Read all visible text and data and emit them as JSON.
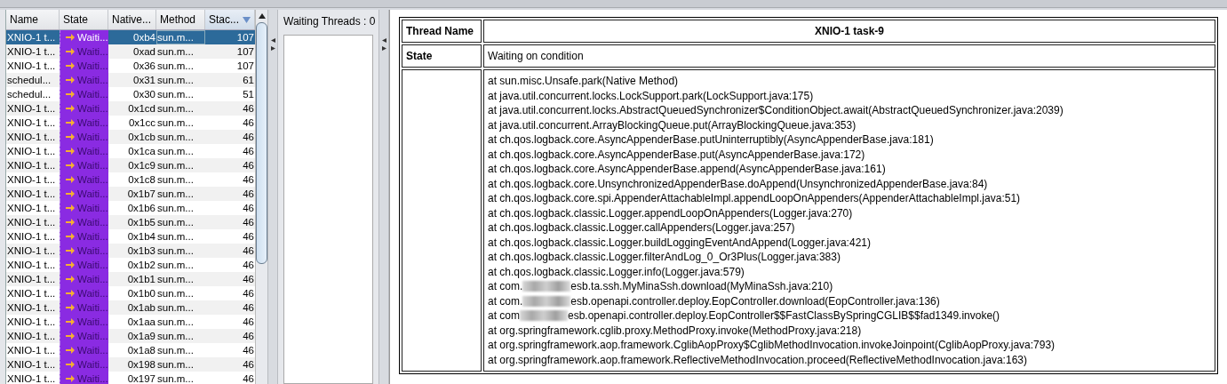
{
  "threads_table": {
    "columns": [
      {
        "label": "Name",
        "sorted": false
      },
      {
        "label": "State",
        "sorted": false
      },
      {
        "label": "Native...",
        "sorted": false
      },
      {
        "label": "Method",
        "sorted": false
      },
      {
        "label": "Stac...",
        "sorted": true
      }
    ],
    "rows": [
      {
        "name": "XNIO-1 t...",
        "state": "Waiti...",
        "native_id": "0xb4",
        "method": "sun.m...",
        "stack_depth": "107",
        "selected": true
      },
      {
        "name": "XNIO-1 t...",
        "state": "Waiti...",
        "native_id": "0xad",
        "method": "sun.m...",
        "stack_depth": "107",
        "selected": false
      },
      {
        "name": "XNIO-1 t...",
        "state": "Waiti...",
        "native_id": "0x36",
        "method": "sun.m...",
        "stack_depth": "107",
        "selected": false
      },
      {
        "name": "schedul...",
        "state": "Waiti...",
        "native_id": "0x31",
        "method": "sun.m...",
        "stack_depth": "61",
        "selected": false
      },
      {
        "name": "schedul...",
        "state": "Waiti...",
        "native_id": "0x30",
        "method": "sun.m...",
        "stack_depth": "51",
        "selected": false
      },
      {
        "name": "XNIO-1 t...",
        "state": "Waiti...",
        "native_id": "0x1cd",
        "method": "sun.m...",
        "stack_depth": "46",
        "selected": false
      },
      {
        "name": "XNIO-1 t...",
        "state": "Waiti...",
        "native_id": "0x1cc",
        "method": "sun.m...",
        "stack_depth": "46",
        "selected": false
      },
      {
        "name": "XNIO-1 t...",
        "state": "Waiti...",
        "native_id": "0x1cb",
        "method": "sun.m...",
        "stack_depth": "46",
        "selected": false
      },
      {
        "name": "XNIO-1 t...",
        "state": "Waiti...",
        "native_id": "0x1ca",
        "method": "sun.m...",
        "stack_depth": "46",
        "selected": false
      },
      {
        "name": "XNIO-1 t...",
        "state": "Waiti...",
        "native_id": "0x1c9",
        "method": "sun.m...",
        "stack_depth": "46",
        "selected": false
      },
      {
        "name": "XNIO-1 t...",
        "state": "Waiti...",
        "native_id": "0x1c8",
        "method": "sun.m...",
        "stack_depth": "46",
        "selected": false
      },
      {
        "name": "XNIO-1 t...",
        "state": "Waiti...",
        "native_id": "0x1b7",
        "method": "sun.m...",
        "stack_depth": "46",
        "selected": false
      },
      {
        "name": "XNIO-1 t...",
        "state": "Waiti...",
        "native_id": "0x1b6",
        "method": "sun.m...",
        "stack_depth": "46",
        "selected": false
      },
      {
        "name": "XNIO-1 t...",
        "state": "Waiti...",
        "native_id": "0x1b5",
        "method": "sun.m...",
        "stack_depth": "46",
        "selected": false
      },
      {
        "name": "XNIO-1 t...",
        "state": "Waiti...",
        "native_id": "0x1b4",
        "method": "sun.m...",
        "stack_depth": "46",
        "selected": false
      },
      {
        "name": "XNIO-1 t...",
        "state": "Waiti...",
        "native_id": "0x1b3",
        "method": "sun.m...",
        "stack_depth": "46",
        "selected": false
      },
      {
        "name": "XNIO-1 t...",
        "state": "Waiti...",
        "native_id": "0x1b2",
        "method": "sun.m...",
        "stack_depth": "46",
        "selected": false
      },
      {
        "name": "XNIO-1 t...",
        "state": "Waiti...",
        "native_id": "0x1b1",
        "method": "sun.m...",
        "stack_depth": "46",
        "selected": false
      },
      {
        "name": "XNIO-1 t...",
        "state": "Waiti...",
        "native_id": "0x1b0",
        "method": "sun.m...",
        "stack_depth": "46",
        "selected": false
      },
      {
        "name": "XNIO-1 t...",
        "state": "Waiti...",
        "native_id": "0x1ab",
        "method": "sun.m...",
        "stack_depth": "46",
        "selected": false
      },
      {
        "name": "XNIO-1 t...",
        "state": "Waiti...",
        "native_id": "0x1aa",
        "method": "sun.m...",
        "stack_depth": "46",
        "selected": false
      },
      {
        "name": "XNIO-1 t...",
        "state": "Waiti...",
        "native_id": "0x1a9",
        "method": "sun.m...",
        "stack_depth": "46",
        "selected": false
      },
      {
        "name": "XNIO-1 t...",
        "state": "Waiti...",
        "native_id": "0x1a8",
        "method": "sun.m...",
        "stack_depth": "46",
        "selected": false
      },
      {
        "name": "XNIO-1 t...",
        "state": "Waiti...",
        "native_id": "0x198",
        "method": "sun.m...",
        "stack_depth": "46",
        "selected": false
      },
      {
        "name": "XNIO-1 t...",
        "state": "Waiti...",
        "native_id": "0x197",
        "method": "sun.m...",
        "stack_depth": "46",
        "selected": false
      }
    ]
  },
  "waiting_threads": {
    "label": "Waiting Threads : 0"
  },
  "thread_details": {
    "name_label": "Thread Name",
    "name_value": "XNIO-1 task-9",
    "state_label": "State",
    "state_value": "Waiting on condition",
    "stack_trace": [
      {
        "text": "at sun.misc.Unsafe.park(Native Method)"
      },
      {
        "text": "at java.util.concurrent.locks.LockSupport.park(LockSupport.java:175)"
      },
      {
        "text": "at java.util.concurrent.locks.AbstractQueuedSynchronizer$ConditionObject.await(AbstractQueuedSynchronizer.java:2039)"
      },
      {
        "text": "at java.util.concurrent.ArrayBlockingQueue.put(ArrayBlockingQueue.java:353)"
      },
      {
        "text": "at ch.qos.logback.core.AsyncAppenderBase.putUninterruptibly(AsyncAppenderBase.java:181)"
      },
      {
        "text": "at ch.qos.logback.core.AsyncAppenderBase.put(AsyncAppenderBase.java:172)"
      },
      {
        "text": "at ch.qos.logback.core.AsyncAppenderBase.append(AsyncAppenderBase.java:161)"
      },
      {
        "text": "at ch.qos.logback.core.UnsynchronizedAppenderBase.doAppend(UnsynchronizedAppenderBase.java:84)"
      },
      {
        "text": "at ch.qos.logback.core.spi.AppenderAttachableImpl.appendLoopOnAppenders(AppenderAttachableImpl.java:51)"
      },
      {
        "text": "at ch.qos.logback.classic.Logger.appendLoopOnAppenders(Logger.java:270)"
      },
      {
        "text": "at ch.qos.logback.classic.Logger.callAppenders(Logger.java:257)"
      },
      {
        "text": "at ch.qos.logback.classic.Logger.buildLoggingEventAndAppend(Logger.java:421)"
      },
      {
        "text": "at ch.qos.logback.classic.Logger.filterAndLog_0_Or3Plus(Logger.java:383)"
      },
      {
        "text": "at ch.qos.logback.classic.Logger.info(Logger.java:579)"
      },
      {
        "text": "at com.",
        "redacted": true,
        "rest": "esb.ta.ssh.MyMinaSsh.download(MyMinaSsh.java:210)"
      },
      {
        "text": "at com.",
        "redacted": true,
        "rest": "esb.openapi.controller.deploy.EopController.download(EopController.java:136)"
      },
      {
        "text": "at com",
        "redacted": true,
        "rest": "esb.openapi.controller.deploy.EopController$$FastClassBySpringCGLIB$$fad1349.invoke()"
      },
      {
        "text": "at org.springframework.cglib.proxy.MethodProxy.invoke(MethodProxy.java:218)"
      },
      {
        "text": "at org.springframework.aop.framework.CglibAopProxy$CglibMethodInvocation.invokeJoinpoint(CglibAopProxy.java:793)"
      },
      {
        "text": "at org.springframework.aop.framework.ReflectiveMethodInvocation.proceed(ReflectiveMethodInvocation.java:163)"
      }
    ]
  }
}
